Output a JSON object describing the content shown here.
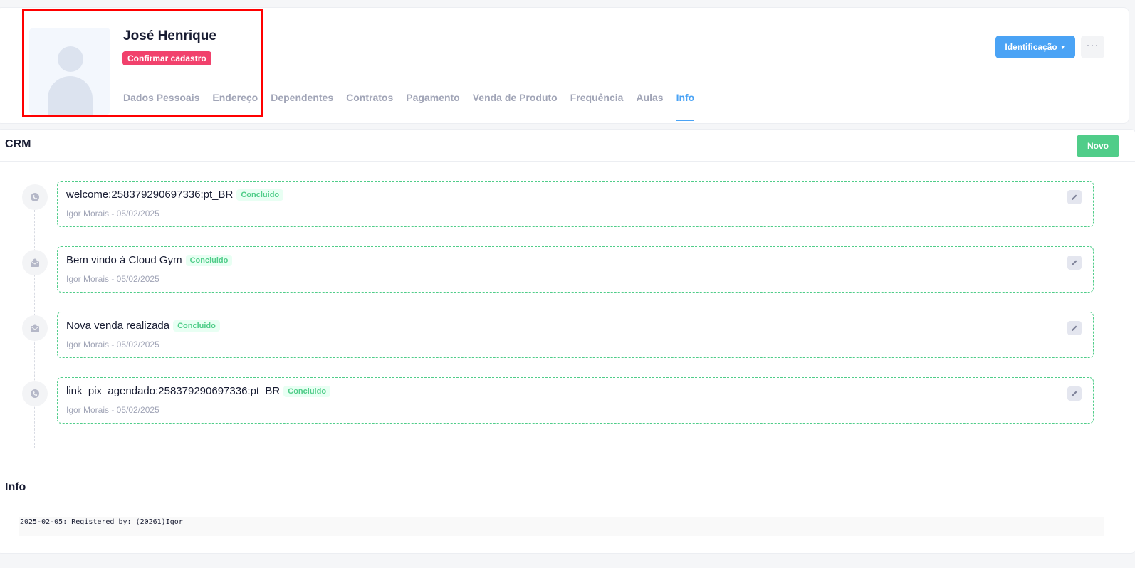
{
  "profile": {
    "name": "José Henrique",
    "confirm_badge": "Confirmar cadastro",
    "tabs": [
      {
        "label": "Dados Pessoais",
        "active": false
      },
      {
        "label": "Endereço",
        "active": false
      },
      {
        "label": "Dependentes",
        "active": false
      },
      {
        "label": "Contratos",
        "active": false
      },
      {
        "label": "Pagamento",
        "active": false
      },
      {
        "label": "Venda de Produto",
        "active": false
      },
      {
        "label": "Frequência",
        "active": false
      },
      {
        "label": "Aulas",
        "active": false
      },
      {
        "label": "Info",
        "active": true
      }
    ],
    "identification_button": "Identificação",
    "more_button": "···"
  },
  "crm": {
    "title": "CRM",
    "new_button": "Novo",
    "items": [
      {
        "icon": "whatsapp-icon",
        "title": "welcome:258379290697336:pt_BR",
        "status": "Concluido",
        "meta": "Igor Morais - 05/02/2025"
      },
      {
        "icon": "email-icon",
        "title": "Bem vindo à Cloud Gym",
        "status": "Concluido",
        "meta": "Igor Morais - 05/02/2025"
      },
      {
        "icon": "email-icon",
        "title": "Nova venda realizada",
        "status": "Concluido",
        "meta": "Igor Morais - 05/02/2025"
      },
      {
        "icon": "whatsapp-icon",
        "title": "link_pix_agendado:258379290697336:pt_BR",
        "status": "Concluido",
        "meta": "Igor Morais - 05/02/2025"
      }
    ]
  },
  "info": {
    "title": "Info",
    "log": "2025-02-05: Registered by: (20261)Igor"
  },
  "colors": {
    "accent": "#4aa3f5",
    "success": "#50cd89",
    "danger": "#f1416c",
    "annotation": "#ff0000"
  }
}
